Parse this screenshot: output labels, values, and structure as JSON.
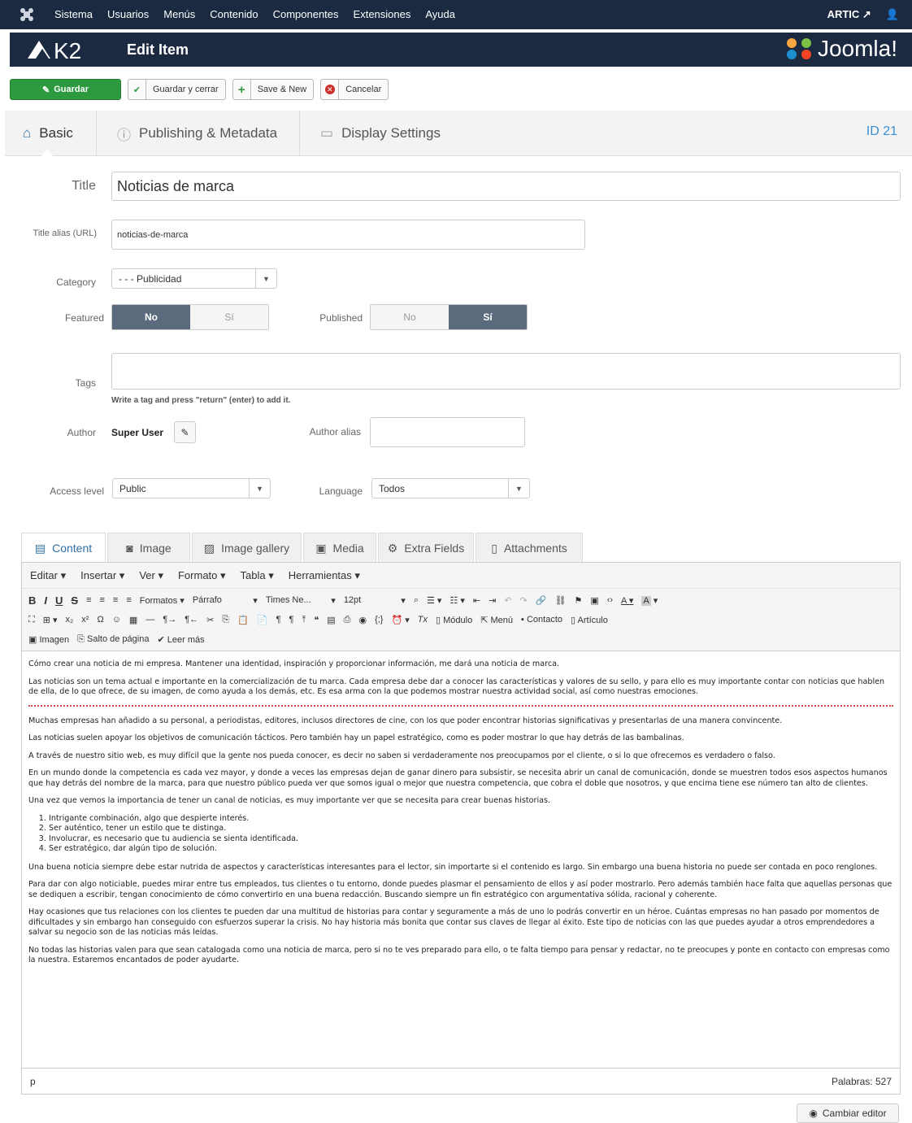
{
  "topbar": {
    "menu": [
      "Sistema",
      "Usuarios",
      "Menús",
      "Contenido",
      "Componentes",
      "Extensiones",
      "Ayuda"
    ],
    "site_name": "ARTIC",
    "user_icon": "user-icon"
  },
  "header": {
    "logo_text": "K2",
    "title": "Edit Item",
    "brand": "Joomla!"
  },
  "toolbar": {
    "save": "Guardar",
    "save_close": "Guardar y cerrar",
    "save_new": "Save & New",
    "cancel": "Cancelar"
  },
  "tabs": {
    "basic": "Basic",
    "publishing": "Publishing & Metadata",
    "display": "Display Settings",
    "id": "ID 21"
  },
  "form": {
    "title_label": "Title",
    "title_value": "Noticias de marca",
    "alias_label": "Title alias (URL)",
    "alias_value": "noticias-de-marca",
    "category_label": "Category",
    "category_value": "- - - Publicidad",
    "featured_label": "Featured",
    "featured_no": "No",
    "featured_yes": "Sí",
    "featured_value": "No",
    "published_label": "Published",
    "published_no": "No",
    "published_yes": "Sí",
    "published_value": "Sí",
    "tags_label": "Tags",
    "tags_hint": "Write a tag and press \"return\" (enter) to add it.",
    "author_label": "Author",
    "author_value": "Super User",
    "author_alias_label": "Author alias",
    "access_label": "Access level",
    "access_value": "Public",
    "language_label": "Language",
    "language_value": "Todos"
  },
  "editor_tabs": {
    "content": "Content",
    "image": "Image",
    "gallery": "Image gallery",
    "media": "Media",
    "extra": "Extra Fields",
    "attachments": "Attachments"
  },
  "editor": {
    "menus": [
      "Editar",
      "Insertar",
      "Ver",
      "Formato",
      "Tabla",
      "Herramientas"
    ],
    "formats": "Formatos",
    "block": "Párrafo",
    "font": "Times Ne...",
    "size": "12pt",
    "modulo": "Módulo",
    "menu": "Menú",
    "contacto": "Contacto",
    "articulo": "Artículo",
    "imagen": "Imagen",
    "salto": "Salto de página",
    "leer_mas": "Leer más",
    "path": "p",
    "word_count": "Palabras: 527",
    "switch": "Cambiar editor"
  },
  "body": {
    "p1": "Cómo crear una noticia de mi empresa. Mantener una identidad, inspiración y proporcionar información, me dará una noticia de marca.",
    "p2": "Las noticias son un tema actual e importante en la comercialización de tu marca. Cada empresa debe dar a conocer las características y valores de su sello, y para ello es muy importante contar con noticias que hablen de ella, de lo que ofrece, de su imagen, de como ayuda a los demás, etc. Es esa arma con la que podemos mostrar nuestra actividad social, así como nuestras emociones.",
    "p3": "Muchas empresas han añadido a su personal, a periodistas, editores, inclusos directores de cine, con los que poder encontrar historias significativas y presentarlas de una manera convincente.",
    "p4": "Las noticias suelen apoyar los objetivos de comunicación tácticos. Pero también hay un papel estratégico, como es poder mostrar lo que hay detrás de las bambalinas.",
    "p5": "A través de nuestro sitio web, es muy difícil que la gente nos pueda conocer, es decir no saben si verdaderamente nos preocupamos por el cliente, o si lo que ofrecemos es verdadero o falso.",
    "p6": "En un mundo donde la competencia es cada vez mayor, y donde a veces las empresas dejan de ganar dinero para subsistir, se necesita abrir un canal de comunicación, donde se muestren todos esos aspectos humanos que hay detrás del nombre de la marca, para que nuestro público pueda ver que somos igual o mejor que nuestra competencia, que cobra el doble que nosotros, y que encima tiene ese número tan alto de clientes.",
    "p7": "Una vez que vemos la importancia de tener un canal de noticias, es muy importante ver que se necesita para crear buenas historias.",
    "list": [
      "Intrigante combinación, algo que despierte interés.",
      "Ser auténtico, tener un estilo que te distinga.",
      "Involucrar, es necesario que tu audiencia se sienta identificada.",
      "Ser estratégico, dar algún tipo de solución."
    ],
    "p8": "Una buena noticia siempre debe estar nutrida de aspectos y características interesantes para el lector, sin importarte si el contenido es largo. Sin embargo una buena historia no puede ser contada en poco renglones.",
    "p9": "Para dar con algo noticiable, puedes mirar entre tus empleados, tus clientes o tu entorno, donde puedes plasmar el pensamiento de ellos y así poder mostrarlo. Pero además también hace falta que aquellas personas que se dediquen a escribir, tengan conocimiento de cómo convertirlo en una buena redacción. Buscando siempre un fin estratégico con argumentativa sólida, racional y coherente.",
    "p10": "Hay ocasiones que tus relaciones con los clientes te pueden dar una multitud de historias para contar y seguramente a más de uno lo podrás convertir en un héroe. Cuántas empresas no han pasado por momentos de dificultades y sin embargo han conseguido con esfuerzos superar la crisis. No hay historia más bonita que contar sus claves de llegar al éxito. Este tipo de noticias con las que puedes ayudar a otros emprendedores a salvar su negocio son de las noticias más leídas.",
    "p11": "No todas las historias valen para que sean catalogada como una noticia de marca, pero si no te ves preparado para ello, o te falta tiempo para pensar y redactar, no te preocupes y ponte en contacto con empresas como la nuestra. Estaremos encantados de poder ayudarte."
  }
}
